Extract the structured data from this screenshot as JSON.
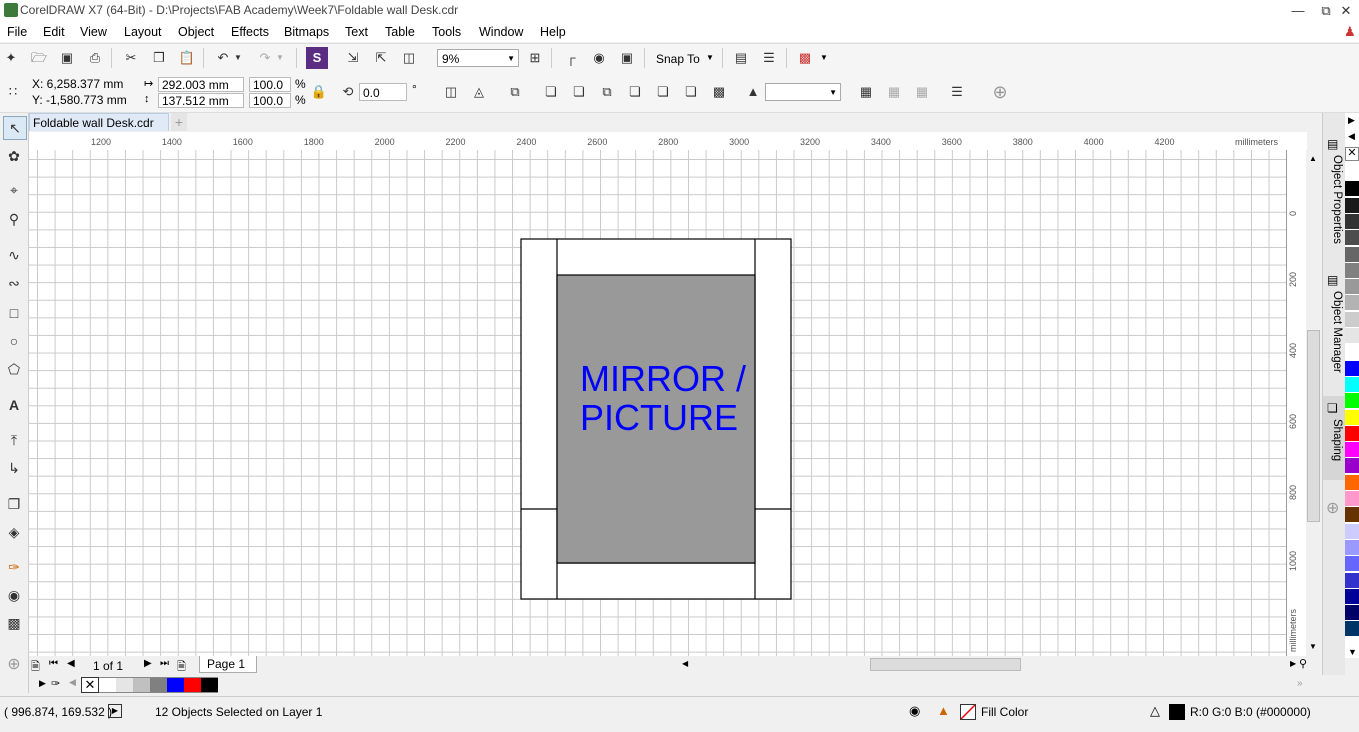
{
  "titlebar": {
    "title": "CorelDRAW X7 (64-Bit) - D:\\Projects\\FAB Academy\\Week7\\Foldable wall Desk.cdr",
    "minimize": "—",
    "restore": "⧉",
    "close": "✕"
  },
  "menu": [
    "File",
    "Edit",
    "View",
    "Layout",
    "Object",
    "Effects",
    "Bitmaps",
    "Text",
    "Table",
    "Tools",
    "Window",
    "Help"
  ],
  "standard": {
    "zoom": "9%",
    "snap_label": "Snap To"
  },
  "props": {
    "x": "X: 6,258.377 mm",
    "y": "Y: -1,580.773 mm",
    "w": "292.003 mm",
    "h": "137.512 mm",
    "sx": "100.0",
    "sy": "100.0",
    "pct1": "%",
    "pct2": "%",
    "angle": "0.0",
    "deg": "°"
  },
  "doc_tab": "Foldable wall Desk.cdr",
  "ruler": {
    "h_ticks": [
      "1200",
      "1400",
      "1600",
      "1800",
      "2000",
      "2200",
      "2400",
      "2600",
      "2800",
      "3000",
      "3200",
      "3400",
      "3600",
      "3800",
      "4000",
      "4200"
    ],
    "h_unit": "millimeters",
    "v_ticks": [
      "0",
      "200",
      "400",
      "600",
      "800",
      "1000"
    ],
    "v_unit": "millimeters"
  },
  "drawing": {
    "text_line1": "MIRROR /",
    "text_line2": "PICTURE",
    "text_color": "#0000ff",
    "panel_fill": "#999999"
  },
  "dockers": [
    "Object Properties",
    "Object Manager",
    "Shaping"
  ],
  "palette": [
    "#ffffff",
    "#000000",
    "#1a1a1a",
    "#333333",
    "#4d4d4d",
    "#666666",
    "#808080",
    "#999999",
    "#b3b3b3",
    "#cccccc",
    "#e5e5e5",
    "#ffffff",
    "#0000ff",
    "#00ffff",
    "#00ff00",
    "#ffff00",
    "#ff0000",
    "#ff00ff",
    "#9900cc",
    "#ff6600",
    "#ff99cc",
    "#663300",
    "#ccccff",
    "#9999ff",
    "#6666ff",
    "#3333cc",
    "#000099",
    "#000066",
    "#003366"
  ],
  "pagenav": {
    "count": "1 of 1",
    "page_tab": "Page 1"
  },
  "doc_palette": [
    "#ffffff",
    "#e5e5e5",
    "#c0c0c0",
    "#808080",
    "#0000ff",
    "#ff0000",
    "#000000"
  ],
  "status": {
    "coords": "( 996.874, 169.532 )",
    "selection": "12 Objects Selected on Layer 1",
    "fill_label": "Fill Color",
    "outline_label": "R:0 G:0 B:0 (#000000)"
  }
}
